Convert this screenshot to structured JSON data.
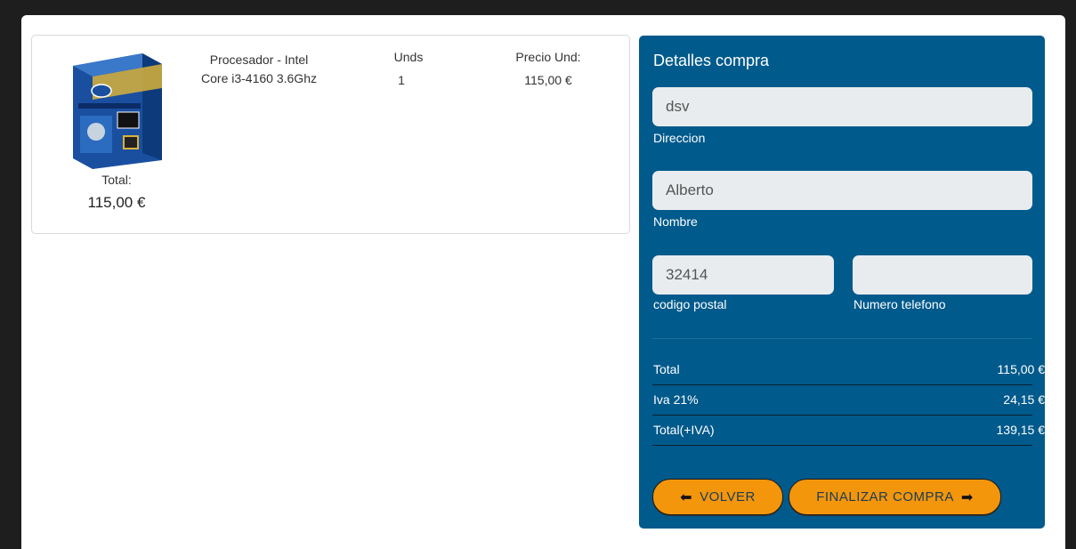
{
  "product": {
    "name": "Procesador - Intel Core i3-4160 3.6Ghz",
    "image_icon": "intel-core-i3-box-icon",
    "total_label": "Total:",
    "total_value": "115,00 €",
    "units_header": "Unds",
    "units_value": "1",
    "price_header": "Precio Und:",
    "price_value": "115,00 €"
  },
  "details": {
    "title": "Detalles compra",
    "address": {
      "value": "dsv",
      "label": "Direccion"
    },
    "name": {
      "value": "Alberto",
      "label": "Nombre"
    },
    "postal_code": {
      "value": "32414",
      "label": "codigo postal"
    },
    "phone": {
      "value": "",
      "label": "Numero telefono"
    }
  },
  "summary": [
    {
      "label": "Total",
      "value": "115,00 €"
    },
    {
      "label": "Iva 21%",
      "value": "24,15 €"
    },
    {
      "label": "Total(+IVA)",
      "value": "139,15 €"
    }
  ],
  "buttons": {
    "back_label": "VOLVER",
    "finish_label": "FINALIZAR COMPRA"
  },
  "colors": {
    "panel_bg": "#005a8c",
    "button_bg": "#f3960b",
    "background": "#1e1e1e"
  }
}
